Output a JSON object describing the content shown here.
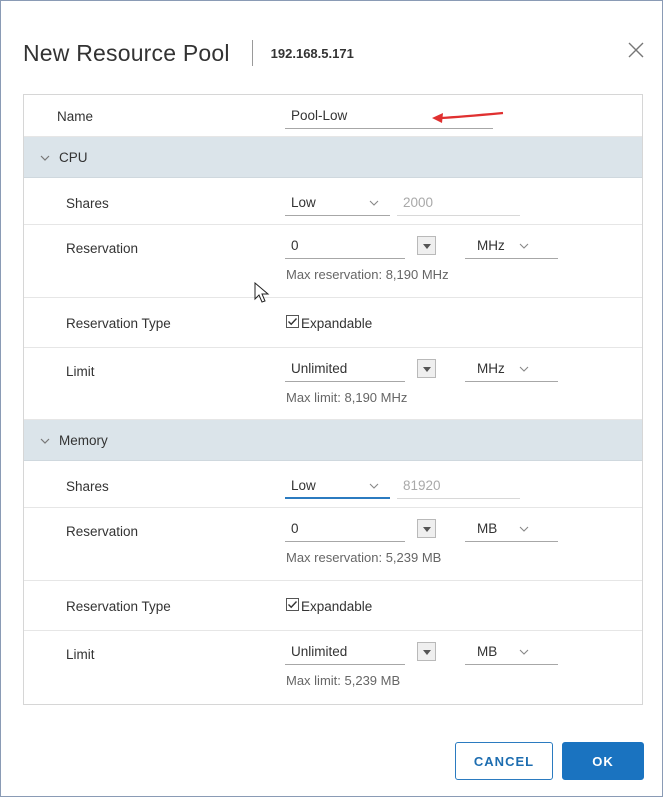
{
  "dialog": {
    "title": "New Resource Pool",
    "host": "192.168.5.171",
    "close_icon": "close-icon"
  },
  "name_row": {
    "label": "Name",
    "value": "Pool-Low"
  },
  "cpu": {
    "section_label": "CPU",
    "shares": {
      "label": "Shares",
      "level": "Low",
      "value": "2000"
    },
    "reservation": {
      "label": "Reservation",
      "value": "0",
      "unit": "MHz",
      "hint": "Max reservation: 8,190 MHz"
    },
    "reservation_type": {
      "label": "Reservation Type",
      "checkbox_label": "Expandable",
      "checked": true
    },
    "limit": {
      "label": "Limit",
      "value": "Unlimited",
      "unit": "MHz",
      "hint": "Max limit: 8,190 MHz"
    }
  },
  "memory": {
    "section_label": "Memory",
    "shares": {
      "label": "Shares",
      "level": "Low",
      "value": "81920"
    },
    "reservation": {
      "label": "Reservation",
      "value": "0",
      "unit": "MB",
      "hint": "Max reservation: 5,239 MB"
    },
    "reservation_type": {
      "label": "Reservation Type",
      "checkbox_label": "Expandable",
      "checked": true
    },
    "limit": {
      "label": "Limit",
      "value": "Unlimited",
      "unit": "MB",
      "hint": "Max limit: 5,239 MB"
    }
  },
  "buttons": {
    "cancel": "CANCEL",
    "ok": "OK"
  },
  "colors": {
    "accent": "#1a73c0",
    "section_bg": "#dbe4ea",
    "annotation_arrow": "#e03030"
  }
}
